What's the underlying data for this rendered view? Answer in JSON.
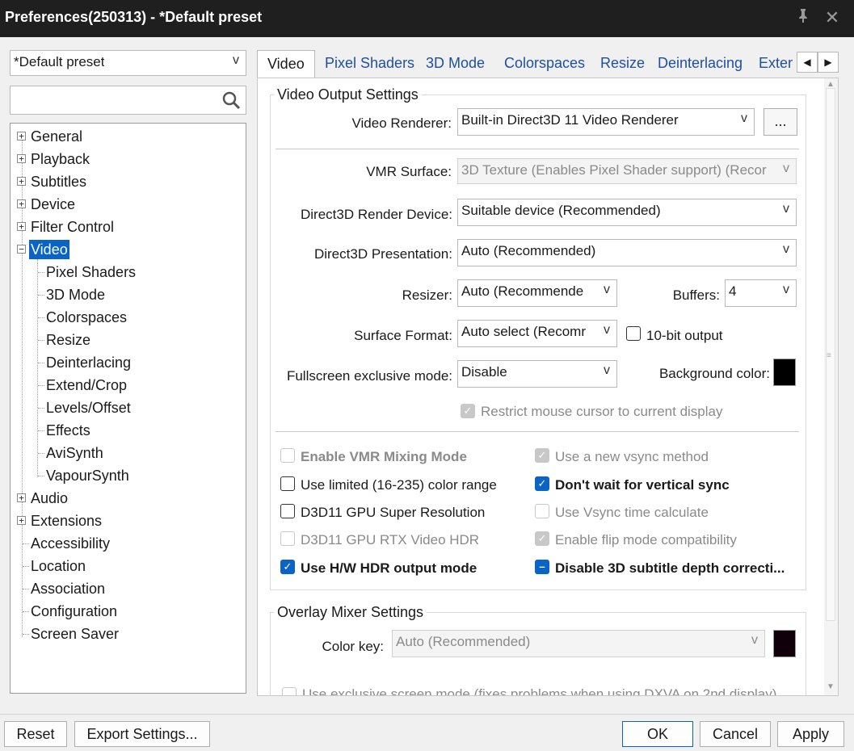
{
  "window": {
    "title": "Preferences(250313) - *Default preset",
    "pin_icon": "pin-icon",
    "close_icon": "close-icon"
  },
  "left": {
    "preset_combo": "*Default preset",
    "search_placeholder": "",
    "tree": [
      {
        "label": "General",
        "expander": "+"
      },
      {
        "label": "Playback",
        "expander": "+"
      },
      {
        "label": "Subtitles",
        "expander": "+"
      },
      {
        "label": "Device",
        "expander": "+"
      },
      {
        "label": "Filter Control",
        "expander": "+"
      },
      {
        "label": "Video",
        "expander": "−",
        "selected": true
      },
      {
        "label": "Pixel Shaders"
      },
      {
        "label": "3D Mode"
      },
      {
        "label": "Colorspaces"
      },
      {
        "label": "Resize"
      },
      {
        "label": "Deinterlacing"
      },
      {
        "label": "Extend/Crop"
      },
      {
        "label": "Levels/Offset"
      },
      {
        "label": "Effects"
      },
      {
        "label": "AviSynth"
      },
      {
        "label": "VapourSynth"
      },
      {
        "label": "Audio",
        "expander": "+"
      },
      {
        "label": "Extensions",
        "expander": "+"
      },
      {
        "label": "Accessibility"
      },
      {
        "label": "Location"
      },
      {
        "label": "Association"
      },
      {
        "label": "Configuration"
      },
      {
        "label": "Screen Saver"
      }
    ]
  },
  "tabs": [
    "Video",
    "Pixel Shaders",
    "3D Mode",
    "Colorspaces",
    "Resize",
    "Deinterlacing",
    "Exten"
  ],
  "video_output": {
    "group_title": "Video Output Settings",
    "renderer_label": "Video Renderer:",
    "renderer_value": "Built-in Direct3D 11 Video Renderer",
    "renderer_more": "...",
    "vmr_surface_label": "VMR Surface:",
    "vmr_surface_value": "3D Texture (Enables Pixel Shader support) (Recor",
    "d3d_device_label": "Direct3D Render Device:",
    "d3d_device_value": "Suitable device (Recommended)",
    "d3d_presentation_label": "Direct3D Presentation:",
    "d3d_presentation_value": "Auto (Recommended)",
    "resizer_label": "Resizer:",
    "resizer_value": "Auto (Recommende",
    "buffers_label": "Buffers:",
    "buffers_value": "4",
    "surface_format_label": "Surface Format:",
    "surface_format_value": "Auto select (Recomr",
    "tenbit_label": "10-bit output",
    "fullscreen_label": "Fullscreen exclusive mode:",
    "fullscreen_value": "Disable",
    "bg_color_label": "Background color:",
    "bg_color": "#000000",
    "restrict_cursor_label": "Restrict mouse cursor to current display",
    "options_left": [
      {
        "label": "Enable VMR Mixing Mode",
        "state": "disabled"
      },
      {
        "label": "Use limited (16-235) color range",
        "state": "unchecked"
      },
      {
        "label": "D3D11 GPU Super Resolution",
        "state": "unchecked"
      },
      {
        "label": "D3D11 GPU RTX Video HDR",
        "state": "disabled"
      },
      {
        "label": "Use H/W HDR output mode",
        "state": "checked"
      }
    ],
    "options_right": [
      {
        "label": "Use a new vsync method",
        "state": "checked-disabled"
      },
      {
        "label": "Don't wait for vertical sync",
        "state": "checked"
      },
      {
        "label": "Use Vsync time calculate",
        "state": "disabled"
      },
      {
        "label": "Enable flip mode compatibility",
        "state": "checked-disabled"
      },
      {
        "label": "Disable 3D subtitle depth correcti...",
        "state": "indeterminate"
      }
    ]
  },
  "overlay": {
    "group_title": "Overlay Mixer Settings",
    "color_key_label": "Color key:",
    "color_key_value": "Auto (Recommended)",
    "color_key_swatch": "#10000a",
    "exclusive_label": "Use exclusive screen mode (fixes problems when using DXVA on 2nd display)"
  },
  "bottom": {
    "reset": "Reset",
    "export": "Export Settings...",
    "ok": "OK",
    "cancel": "Cancel",
    "apply": "Apply"
  }
}
